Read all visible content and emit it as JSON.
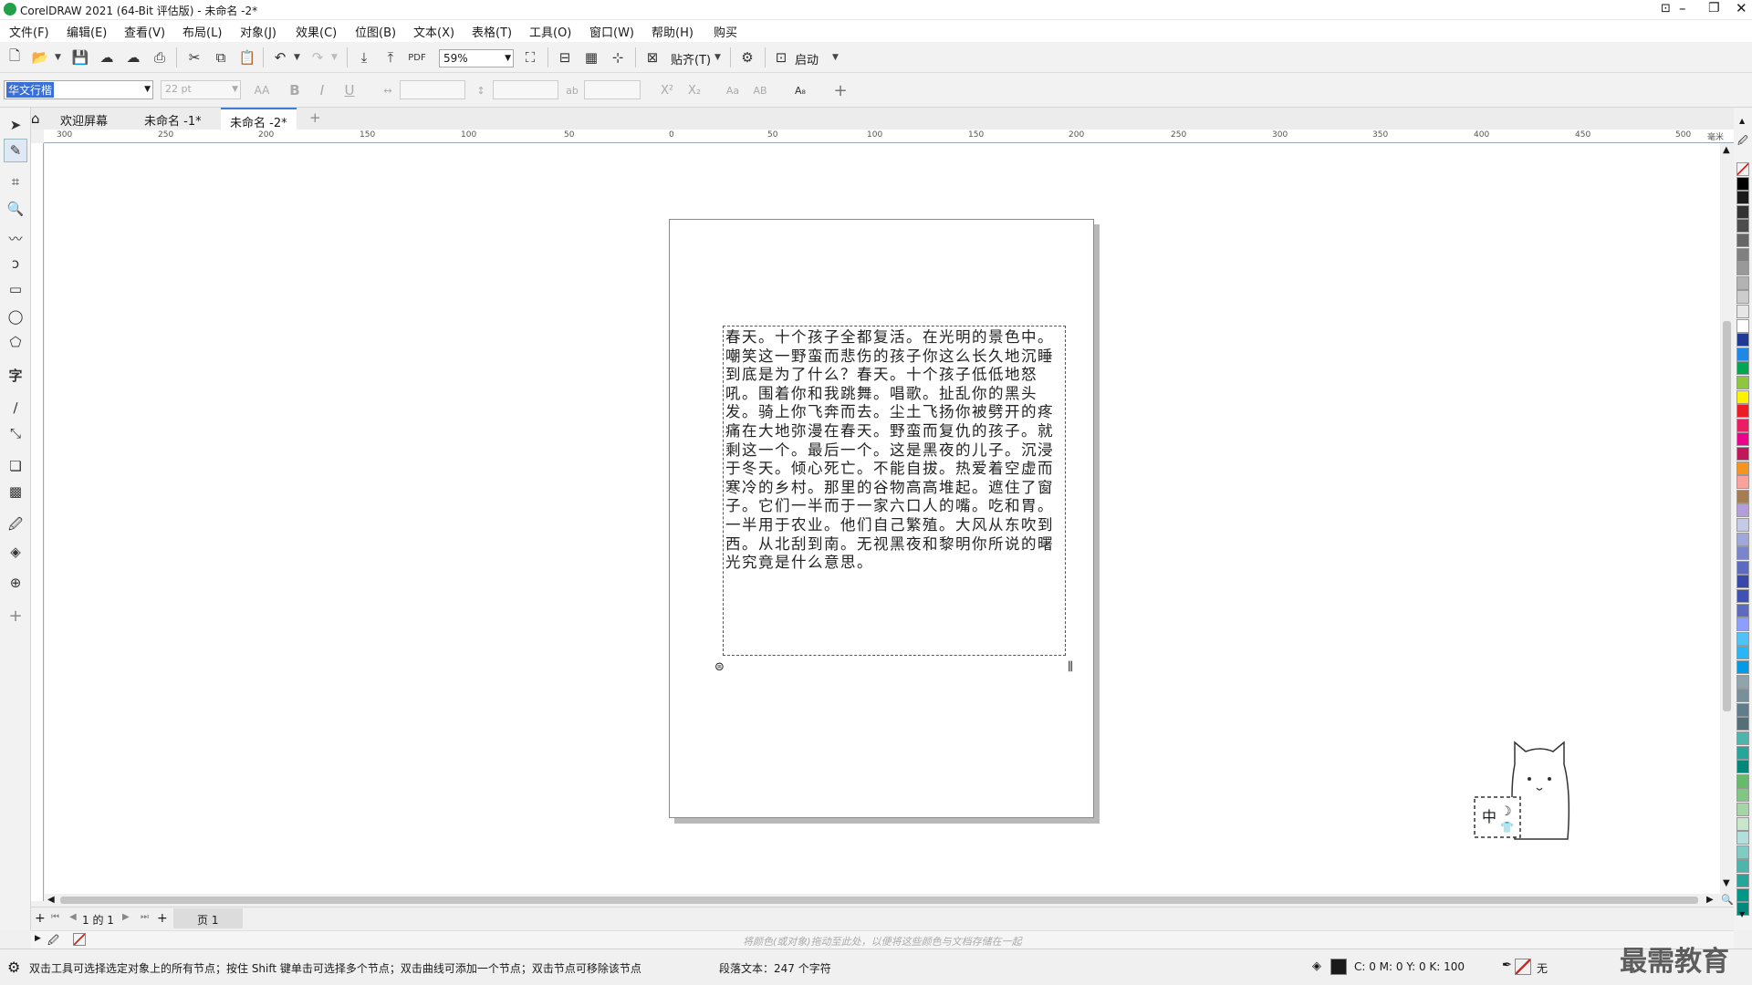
{
  "titlebar": {
    "title": "CorelDRAW 2021 (64-Bit 评估版) - 未命名 -2*"
  },
  "menu": [
    "文件(F)",
    "编辑(E)",
    "查看(V)",
    "布局(L)",
    "对象(J)",
    "效果(C)",
    "位图(B)",
    "文本(X)",
    "表格(T)",
    "工具(O)",
    "窗口(W)",
    "帮助(H)",
    "购买"
  ],
  "toolbar": {
    "zoom": "59%",
    "snap": "贴齐(T)",
    "launch": "启动"
  },
  "propbar": {
    "font": "华文行楷",
    "size": "22 pt",
    "superscript": "X²",
    "subscript": "X₂"
  },
  "tabs": {
    "welcome": "欢迎屏幕",
    "doc1": "未命名 -1*",
    "doc2": "未命名 -2*"
  },
  "ruler": {
    "labels": [
      "300",
      "250",
      "200",
      "150",
      "100",
      "50",
      "0",
      "50",
      "100",
      "150",
      "200",
      "250",
      "300",
      "350",
      "400",
      "450",
      "500"
    ],
    "unit": "毫米"
  },
  "poem": "春天。十个孩子全都复活。在光明的景色中。嘲笑这一野蛮而悲伤的孩子你这么长久地沉睡到底是为了什么？春天。十个孩子低低地怒吼。围着你和我跳舞。唱歌。扯乱你的黑头发。骑上你飞奔而去。尘土飞扬你被劈开的疼痛在大地弥漫在春天。野蛮而复仇的孩子。就剩这一个。最后一个。这是黑夜的儿子。沉浸于冬天。倾心死亡。不能自拔。热爱着空虚而寒冷的乡村。那里的谷物高高堆起。遮住了窗子。它们一半而于一家六口人的嘴。吃和胃。一半用于农业。他们自己繁殖。大风从东吹到西。从北刮到南。无视黑夜和黎明你所说的曙光究竟是什么意思。",
  "pager": {
    "of": "1 的 1",
    "page": "页 1"
  },
  "docpal_hint": "将颜色(或对象)拖动至此处，以便将这些颜色与文档存储在一起",
  "status": {
    "hint": "双击工具可选择选定对象上的所有节点；按住 Shift 键单击可选择多个节点；双击曲线可添加一个节点；双击节点可移除该节点",
    "para": "段落文本：247 个字符",
    "cmyk": "C: 0 M: 0 Y: 0 K: 100",
    "none": "无"
  },
  "ime": {
    "label": "中"
  },
  "watermark": "最需教育",
  "palette": [
    "#ffffff",
    "#000000",
    "#1a1a1a",
    "#333333",
    "#4d4d4d",
    "#666666",
    "#808080",
    "#999999",
    "#b3b3b3",
    "#cccccc",
    "#e6e6e6",
    "#ffffff",
    "#1f3a93",
    "#1e88e5",
    "#00a651",
    "#8dc63f",
    "#fff200",
    "#ed1c24",
    "#e91e63",
    "#ec008c",
    "#c2185b",
    "#f7941d",
    "#f9a19a",
    "#a67c52",
    "#b39ddb",
    "#c5cae9",
    "#9fa8da",
    "#7986cb",
    "#5c6bc0",
    "#3949ab",
    "#3f51b5",
    "#5c6bc0",
    "#8c9eff",
    "#4fc3f7",
    "#29b6f6",
    "#039be5",
    "#90a4ae",
    "#78909c",
    "#607d8b",
    "#546e7a",
    "#4db6ac",
    "#26a69a",
    "#00897b",
    "#66bb6a",
    "#81c784",
    "#a5d6a7",
    "#c8e6c9",
    "#b2dfdb",
    "#80cbc4",
    "#4db6ac",
    "#26a69a",
    "#009688",
    "#00897b"
  ]
}
